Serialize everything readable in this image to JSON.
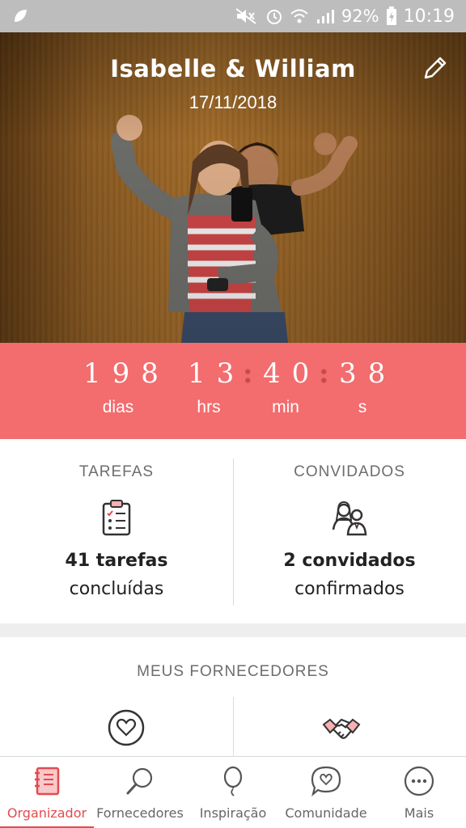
{
  "status_bar": {
    "battery": "92%",
    "time": "10:19",
    "icons": [
      "app-icon",
      "mute-icon",
      "alarm-icon",
      "wifi-icon",
      "signal-icon",
      "battery-charging-icon"
    ]
  },
  "header": {
    "couple_names": "Isabelle & William",
    "wedding_date": "17/11/2018",
    "edit_icon": "pencil-icon"
  },
  "countdown": {
    "days": "198",
    "hours": "13",
    "minutes": "40",
    "seconds": "38",
    "days_label": "dias",
    "hours_label": "hrs",
    "minutes_label": "min",
    "seconds_label": "s",
    "separator": ":"
  },
  "stats": {
    "tasks": {
      "title": "TAREFAS",
      "count": "41 tarefas",
      "sub": "concluídas",
      "icon": "clipboard-checklist-icon"
    },
    "guests": {
      "title": "CONVIDADOS",
      "count": "2 convidados",
      "sub": "confirmados",
      "icon": "guests-couple-icon"
    }
  },
  "vendors": {
    "title": "MEUS FORNECEDORES",
    "items": [
      {
        "icon": "heart-circle-icon"
      },
      {
        "icon": "handshake-icon"
      }
    ]
  },
  "bottom_nav": {
    "items": [
      {
        "label": "Organizador",
        "icon": "notebook-icon",
        "active": true
      },
      {
        "label": "Fornecedores",
        "icon": "magnifier-icon",
        "active": false
      },
      {
        "label": "Inspiração",
        "icon": "balloon-icon",
        "active": false
      },
      {
        "label": "Comunidade",
        "icon": "chat-heart-icon",
        "active": false
      },
      {
        "label": "Mais",
        "icon": "more-dots-icon",
        "active": false
      }
    ]
  },
  "colors": {
    "accent": "#f36c6e",
    "nav_active": "#e24b4f",
    "status_bar": "#bdbdbd"
  }
}
